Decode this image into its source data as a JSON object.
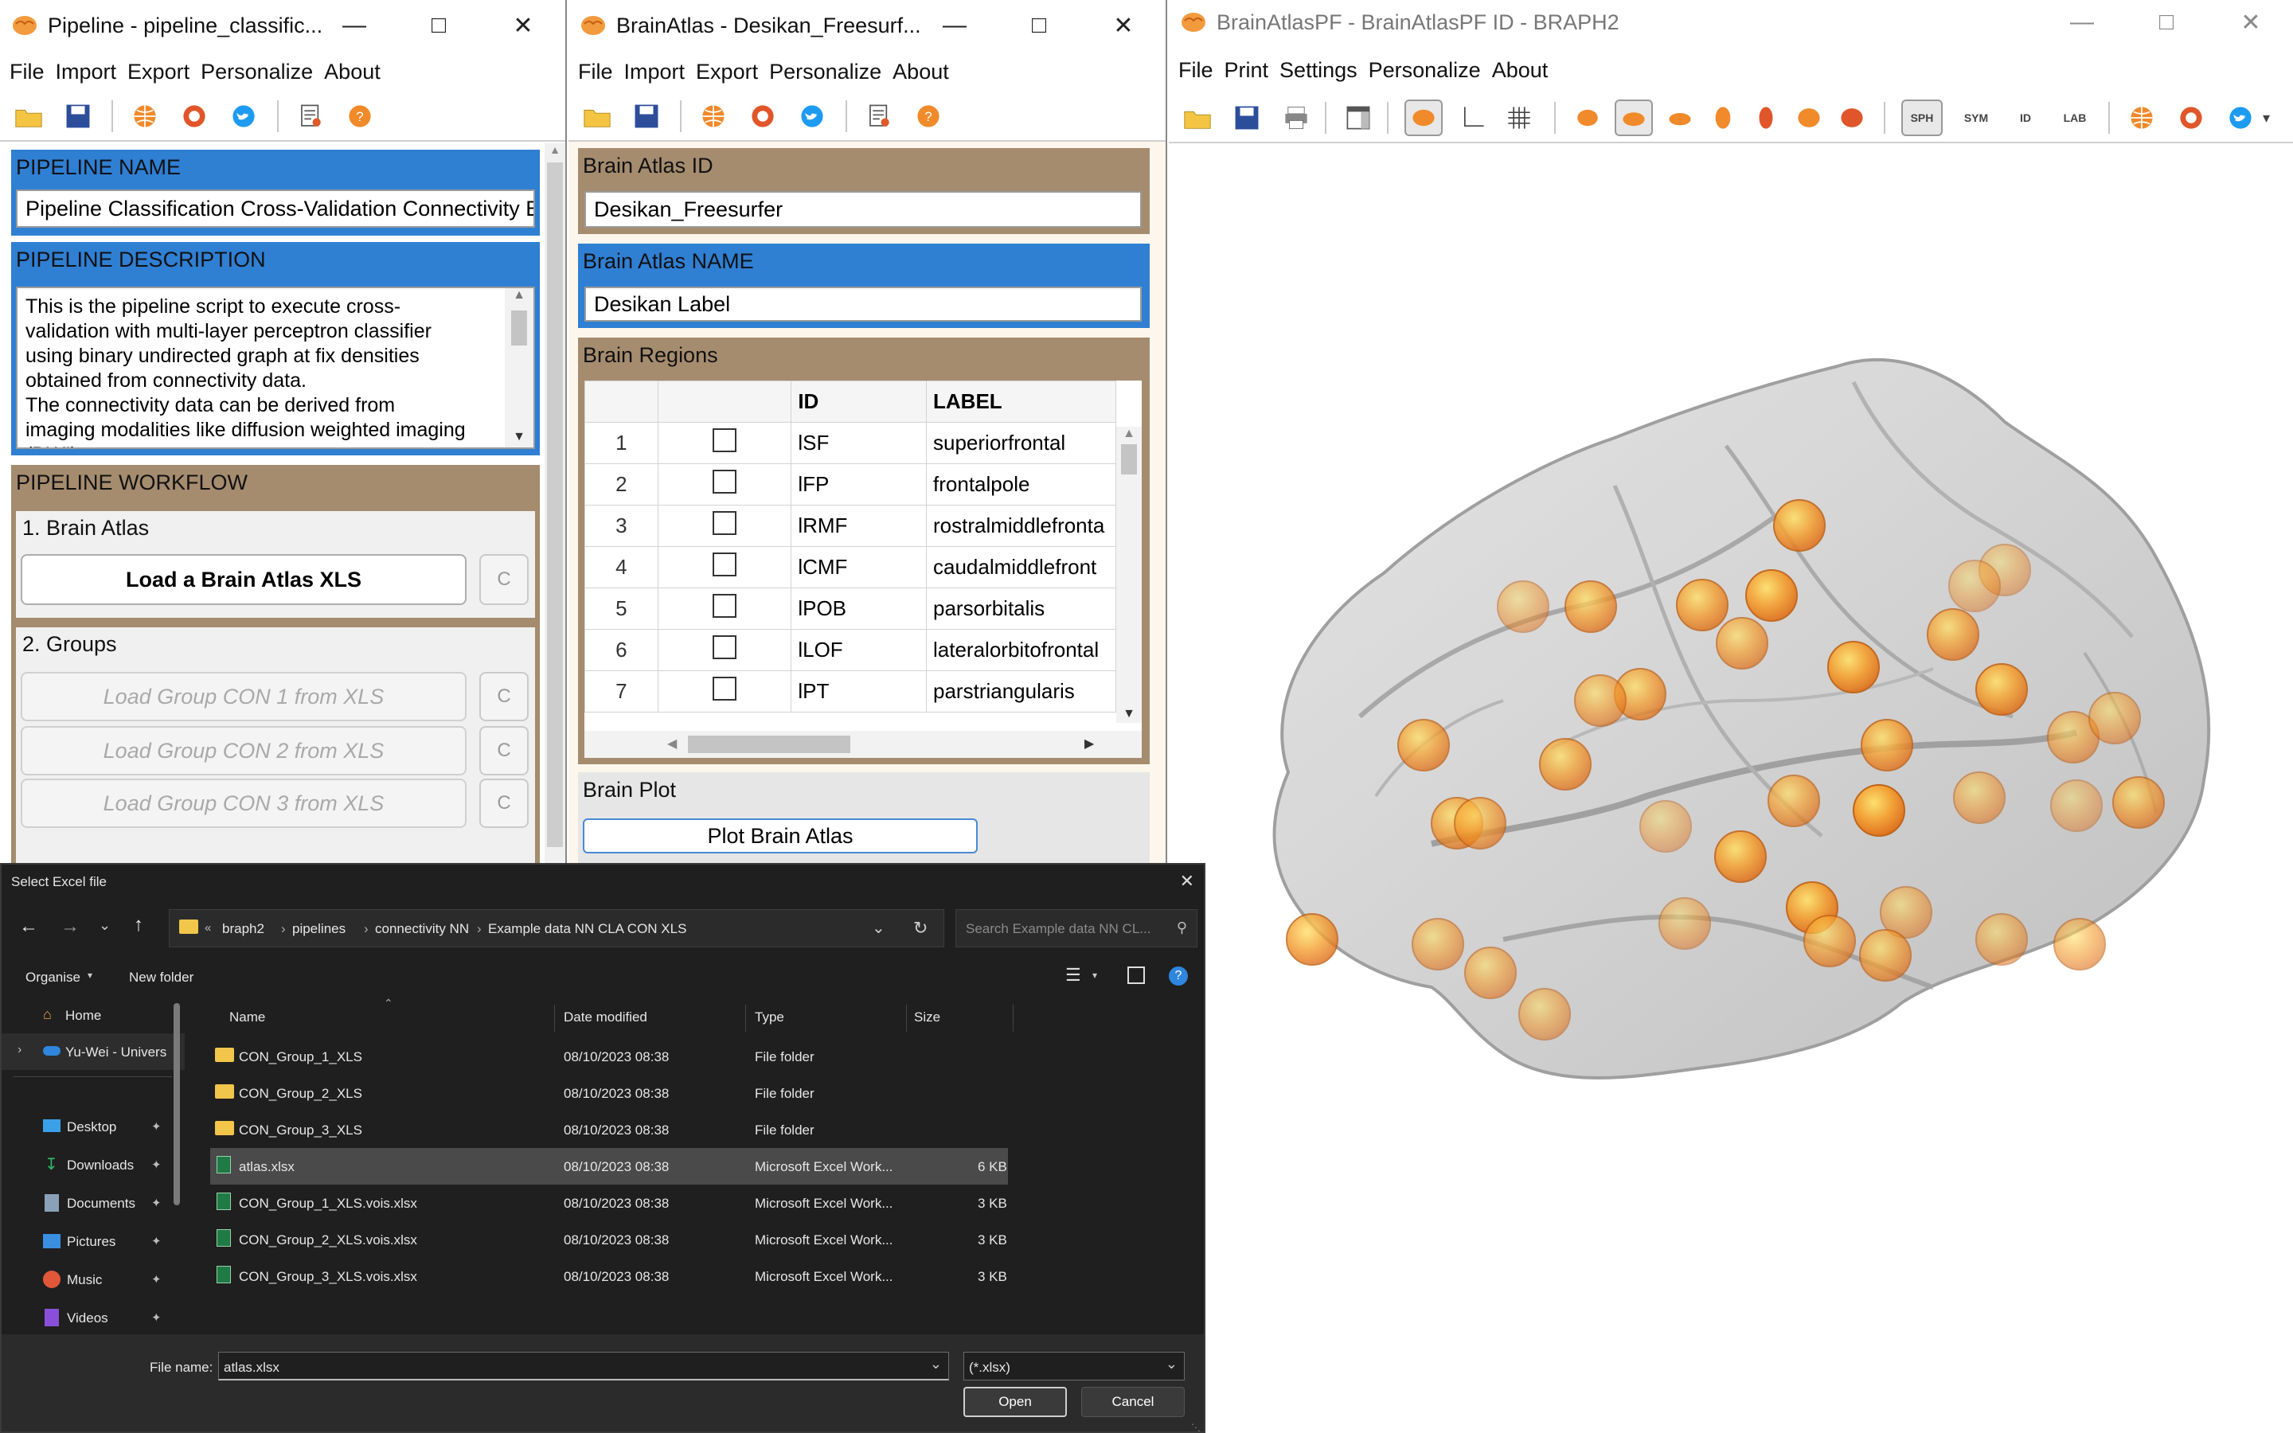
{
  "pipeline_window": {
    "title": "Pipeline - pipeline_classific...",
    "menu": [
      "File",
      "Import",
      "Export",
      "Personalize",
      "About"
    ],
    "name_header": "PIPELINE NAME",
    "name_value": "Pipeline Classification Cross-Validation Connectivity E",
    "desc_header": "PIPELINE DESCRIPTION",
    "desc_lines": [
      "This is the pipeline script to execute cross-",
      "validation with multi-layer perceptron classifier",
      "using binary undirected graph at fix densities",
      "obtained from connectivity data.",
      "The connectivity data can be derived from",
      "imaging modalities like diffusion weighted imaging",
      "(DWI)"
    ],
    "workflow_header": "PIPELINE WORKFLOW",
    "step1_label": "1. Brain Atlas",
    "step1_button": "Load a Brain Atlas XLS",
    "step2_label": "2. Groups",
    "group_buttons": [
      "Load Group CON 1 from XLS",
      "Load Group CON 2 from XLS",
      "Load Group CON 3 from XLS"
    ],
    "c_label": "C"
  },
  "brainatlas_window": {
    "title": "BrainAtlas - Desikan_Freesurf...",
    "menu": [
      "File",
      "Import",
      "Export",
      "Personalize",
      "About"
    ],
    "id_header": "Brain Atlas ID",
    "id_value": "Desikan_Freesurfer",
    "name_header": "Brain Atlas NAME",
    "name_value": "Desikan Label",
    "regions_header": "Brain Regions",
    "columns": [
      "ID",
      "LABEL"
    ],
    "rows": [
      {
        "n": "1",
        "id": "lSF",
        "label": "superiorfrontal"
      },
      {
        "n": "2",
        "id": "lFP",
        "label": "frontalpole"
      },
      {
        "n": "3",
        "id": "lRMF",
        "label": "rostralmiddlefronta"
      },
      {
        "n": "4",
        "id": "lCMF",
        "label": "caudalmiddlefront"
      },
      {
        "n": "5",
        "id": "lPOB",
        "label": "parsorbitalis"
      },
      {
        "n": "6",
        "id": "lLOF",
        "label": "lateralorbitofrontal"
      },
      {
        "n": "7",
        "id": "lPT",
        "label": "parstriangularis"
      }
    ],
    "plot_header": "Brain Plot",
    "plot_button": "Plot Brain Atlas"
  },
  "brainplot_window": {
    "title": "BrainAtlasPF - BrainAtlasPF ID - BRAPH2",
    "menu": [
      "File",
      "Print",
      "Settings",
      "Personalize",
      "About"
    ],
    "tb_labels": [
      "SPH",
      "SYM",
      "ID",
      "LAB"
    ]
  },
  "file_dialog": {
    "title": "Select Excel file",
    "breadcrumb": [
      "braph2",
      "pipelines",
      "connectivity NN",
      "Example data NN CLA CON XLS"
    ],
    "search_placeholder": "Search Example data NN CL...",
    "organise": "Organise",
    "new_folder": "New folder",
    "columns": {
      "name": "Name",
      "date": "Date modified",
      "type": "Type",
      "size": "Size"
    },
    "sidebar": [
      {
        "label": "Home",
        "pin": false
      },
      {
        "label": "Yu-Wei - Univers",
        "pin": false
      },
      {
        "label": "Desktop",
        "pin": true
      },
      {
        "label": "Downloads",
        "pin": true
      },
      {
        "label": "Documents",
        "pin": true
      },
      {
        "label": "Pictures",
        "pin": true
      },
      {
        "label": "Music",
        "pin": true
      },
      {
        "label": "Videos",
        "pin": true
      }
    ],
    "files": [
      {
        "name": "CON_Group_1_XLS",
        "date": "08/10/2023 08:38",
        "type": "File folder",
        "size": "",
        "kind": "folder"
      },
      {
        "name": "CON_Group_2_XLS",
        "date": "08/10/2023 08:38",
        "type": "File folder",
        "size": "",
        "kind": "folder"
      },
      {
        "name": "CON_Group_3_XLS",
        "date": "08/10/2023 08:38",
        "type": "File folder",
        "size": "",
        "kind": "folder"
      },
      {
        "name": "atlas.xlsx",
        "date": "08/10/2023 08:38",
        "type": "Microsoft Excel Work...",
        "size": "6 KB",
        "kind": "excel",
        "selected": true
      },
      {
        "name": "CON_Group_1_XLS.vois.xlsx",
        "date": "08/10/2023 08:38",
        "type": "Microsoft Excel Work...",
        "size": "3 KB",
        "kind": "excel"
      },
      {
        "name": "CON_Group_2_XLS.vois.xlsx",
        "date": "08/10/2023 08:38",
        "type": "Microsoft Excel Work...",
        "size": "3 KB",
        "kind": "excel"
      },
      {
        "name": "CON_Group_3_XLS.vois.xlsx",
        "date": "08/10/2023 08:38",
        "type": "Microsoft Excel Work...",
        "size": "3 KB",
        "kind": "excel"
      }
    ],
    "filename_label": "File name:",
    "filename_value": "atlas.xlsx",
    "filter_value": "(*.xlsx)",
    "open_button": "Open",
    "cancel_button": "Cancel"
  },
  "colors": {
    "blue_header": "#2f7fd3",
    "brown_header": "#a58c6e",
    "node": "#f5a030",
    "dialog_bg": "#1c1c1c",
    "selected_row": "#4a4a4a"
  }
}
